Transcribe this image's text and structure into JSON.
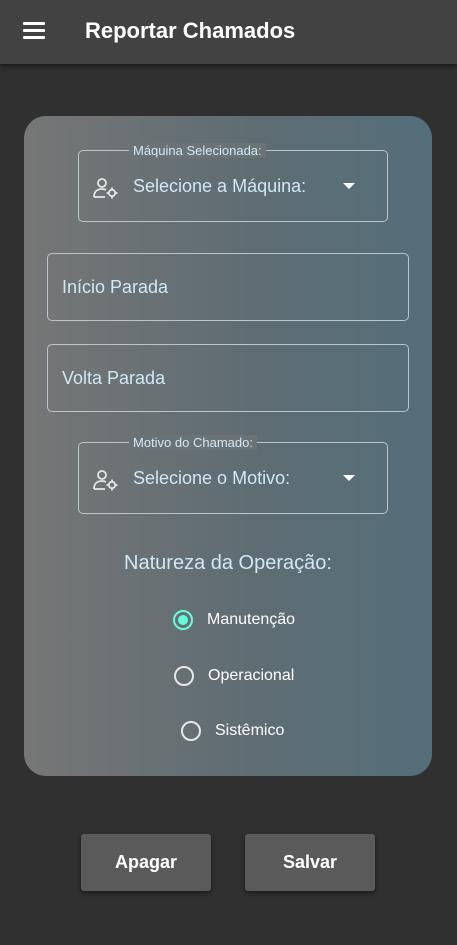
{
  "appbar": {
    "title": "Reportar Chamados",
    "menu_icon": "menu-icon"
  },
  "form": {
    "machine": {
      "legend": "Máquina Selecionada:",
      "value": "Selecione a Máquina:",
      "icon": "person-gear-icon"
    },
    "inicio": {
      "label": "Início Parada"
    },
    "volta": {
      "label": "Volta Parada"
    },
    "motivo": {
      "legend": "Motivo do Chamado:",
      "value": "Selecione o Motivo:",
      "icon": "person-gear-icon"
    },
    "natureza": {
      "title": "Natureza da Operação:",
      "options": [
        {
          "label": "Manutenção",
          "checked": true
        },
        {
          "label": "Operacional",
          "checked": false
        },
        {
          "label": "Sistêmico",
          "checked": false
        }
      ]
    }
  },
  "buttons": {
    "apagar": "Apagar",
    "salvar": "Salvar"
  },
  "colors": {
    "accent": "#64ffda",
    "label": "#cfe8f5",
    "background": "#303030"
  }
}
